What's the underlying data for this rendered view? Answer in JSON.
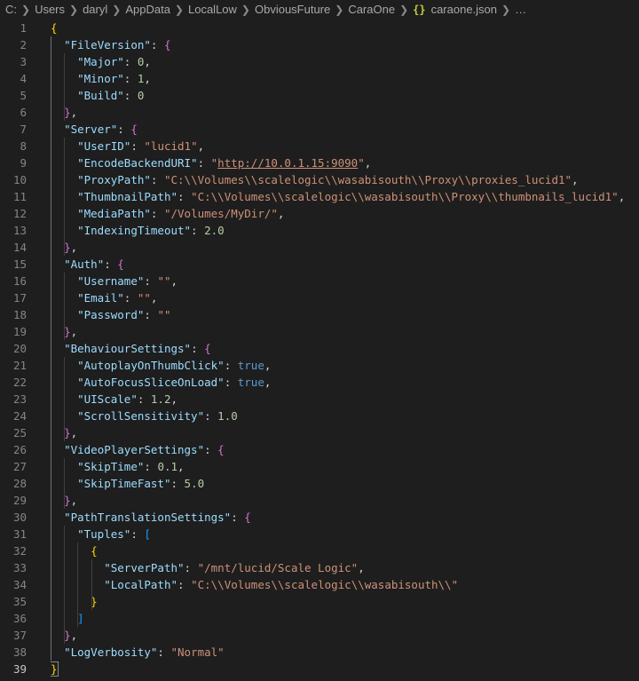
{
  "breadcrumb": {
    "segments": [
      "C:",
      "Users",
      "daryl",
      "AppData",
      "LocalLow",
      "ObviousFuture",
      "CaraOne",
      "caraone.json",
      "…"
    ],
    "file_icon_glyph": "{}"
  },
  "editor": {
    "lines": [
      [
        [
          "b1",
          "{"
        ]
      ],
      [
        [
          "k",
          "\"FileVersion\""
        ],
        [
          "p",
          ": "
        ],
        [
          "b2",
          "{"
        ]
      ],
      [
        [
          "k",
          "\"Major\""
        ],
        [
          "p",
          ": "
        ],
        [
          "n",
          "0"
        ],
        [
          "p",
          ","
        ]
      ],
      [
        [
          "k",
          "\"Minor\""
        ],
        [
          "p",
          ": "
        ],
        [
          "n",
          "1"
        ],
        [
          "p",
          ","
        ]
      ],
      [
        [
          "k",
          "\"Build\""
        ],
        [
          "p",
          ": "
        ],
        [
          "n",
          "0"
        ]
      ],
      [
        [
          "b2",
          "}"
        ],
        [
          "p",
          ","
        ]
      ],
      [
        [
          "k",
          "\"Server\""
        ],
        [
          "p",
          ": "
        ],
        [
          "b2",
          "{"
        ]
      ],
      [
        [
          "k",
          "\"UserID\""
        ],
        [
          "p",
          ": "
        ],
        [
          "s",
          "\"lucid1\""
        ],
        [
          "p",
          ","
        ]
      ],
      [
        [
          "k",
          "\"EncodeBackendURI\""
        ],
        [
          "p",
          ": "
        ],
        [
          "s",
          "\""
        ],
        [
          "su",
          "http://10.0.1.15:9090"
        ],
        [
          "s",
          "\""
        ],
        [
          "p",
          ","
        ]
      ],
      [
        [
          "k",
          "\"ProxyPath\""
        ],
        [
          "p",
          ": "
        ],
        [
          "s",
          "\"C:\\\\Volumes\\\\scalelogic\\\\wasabisouth\\\\Proxy\\\\proxies_lucid1\""
        ],
        [
          "p",
          ","
        ]
      ],
      [
        [
          "k",
          "\"ThumbnailPath\""
        ],
        [
          "p",
          ": "
        ],
        [
          "s",
          "\"C:\\\\Volumes\\\\scalelogic\\\\wasabisouth\\\\Proxy\\\\thumbnails_lucid1\""
        ],
        [
          "p",
          ","
        ]
      ],
      [
        [
          "k",
          "\"MediaPath\""
        ],
        [
          "p",
          ": "
        ],
        [
          "s",
          "\"/Volumes/MyDir/\""
        ],
        [
          "p",
          ","
        ]
      ],
      [
        [
          "k",
          "\"IndexingTimeout\""
        ],
        [
          "p",
          ": "
        ],
        [
          "n",
          "2.0"
        ]
      ],
      [
        [
          "b2",
          "}"
        ],
        [
          "p",
          ","
        ]
      ],
      [
        [
          "k",
          "\"Auth\""
        ],
        [
          "p",
          ": "
        ],
        [
          "b2",
          "{"
        ]
      ],
      [
        [
          "k",
          "\"Username\""
        ],
        [
          "p",
          ": "
        ],
        [
          "s",
          "\"\""
        ],
        [
          "p",
          ","
        ]
      ],
      [
        [
          "k",
          "\"Email\""
        ],
        [
          "p",
          ": "
        ],
        [
          "s",
          "\"\""
        ],
        [
          "p",
          ","
        ]
      ],
      [
        [
          "k",
          "\"Password\""
        ],
        [
          "p",
          ": "
        ],
        [
          "s",
          "\"\""
        ]
      ],
      [
        [
          "b2",
          "}"
        ],
        [
          "p",
          ","
        ]
      ],
      [
        [
          "k",
          "\"BehaviourSettings\""
        ],
        [
          "p",
          ": "
        ],
        [
          "b2",
          "{"
        ]
      ],
      [
        [
          "k",
          "\"AutoplayOnThumbClick\""
        ],
        [
          "p",
          ": "
        ],
        [
          "b",
          "true"
        ],
        [
          "p",
          ","
        ]
      ],
      [
        [
          "k",
          "\"AutoFocusSliceOnLoad\""
        ],
        [
          "p",
          ": "
        ],
        [
          "b",
          "true"
        ],
        [
          "p",
          ","
        ]
      ],
      [
        [
          "k",
          "\"UIScale\""
        ],
        [
          "p",
          ": "
        ],
        [
          "n",
          "1.2"
        ],
        [
          "p",
          ","
        ]
      ],
      [
        [
          "k",
          "\"ScrollSensitivity\""
        ],
        [
          "p",
          ": "
        ],
        [
          "n",
          "1.0"
        ]
      ],
      [
        [
          "b2",
          "}"
        ],
        [
          "p",
          ","
        ]
      ],
      [
        [
          "k",
          "\"VideoPlayerSettings\""
        ],
        [
          "p",
          ": "
        ],
        [
          "b2",
          "{"
        ]
      ],
      [
        [
          "k",
          "\"SkipTime\""
        ],
        [
          "p",
          ": "
        ],
        [
          "n",
          "0.1"
        ],
        [
          "p",
          ","
        ]
      ],
      [
        [
          "k",
          "\"SkipTimeFast\""
        ],
        [
          "p",
          ": "
        ],
        [
          "n",
          "5.0"
        ]
      ],
      [
        [
          "b2",
          "}"
        ],
        [
          "p",
          ","
        ]
      ],
      [
        [
          "k",
          "\"PathTranslationSettings\""
        ],
        [
          "p",
          ": "
        ],
        [
          "b2",
          "{"
        ]
      ],
      [
        [
          "k",
          "\"Tuples\""
        ],
        [
          "p",
          ": "
        ],
        [
          "b3",
          "["
        ]
      ],
      [
        [
          "b1",
          "{"
        ]
      ],
      [
        [
          "k",
          "\"ServerPath\""
        ],
        [
          "p",
          ": "
        ],
        [
          "s",
          "\"/mnt/lucid/Scale Logic\""
        ],
        [
          "p",
          ","
        ]
      ],
      [
        [
          "k",
          "\"LocalPath\""
        ],
        [
          "p",
          ": "
        ],
        [
          "s",
          "\"C:\\\\Volumes\\\\scalelogic\\\\wasabisouth\\\\\""
        ]
      ],
      [
        [
          "b1",
          "}"
        ]
      ],
      [
        [
          "b3",
          "]"
        ]
      ],
      [
        [
          "b2",
          "}"
        ],
        [
          "p",
          ","
        ]
      ],
      [
        [
          "k",
          "\"LogVerbosity\""
        ],
        [
          "p",
          ": "
        ],
        [
          "s",
          "\"Normal\""
        ]
      ],
      [
        [
          "b1m",
          "}"
        ]
      ]
    ]
  }
}
